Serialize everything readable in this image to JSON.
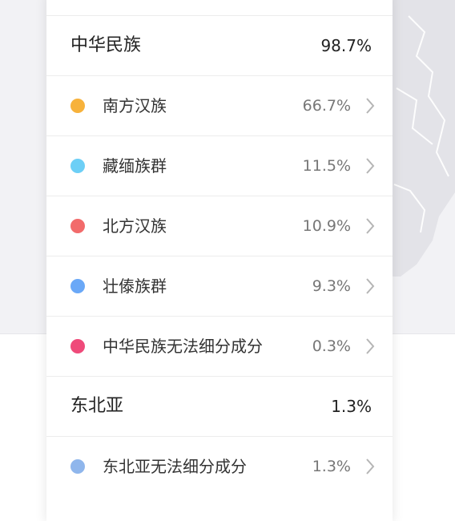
{
  "groups": [
    {
      "label": "中华民族",
      "value": "98.7%",
      "items": [
        {
          "label": "南方汉族",
          "value": "66.7%",
          "color": "#f7b23b"
        },
        {
          "label": "藏缅族群",
          "value": "11.5%",
          "color": "#6dcff6"
        },
        {
          "label": "北方汉族",
          "value": "10.9%",
          "color": "#f26b6b"
        },
        {
          "label": "壮傣族群",
          "value": "9.3%",
          "color": "#6aa8f7"
        },
        {
          "label": "中华民族无法细分成分",
          "value": "0.3%",
          "color": "#ef4a7a"
        }
      ]
    },
    {
      "label": "东北亚",
      "value": "1.3%",
      "items": [
        {
          "label": "东北亚无法细分成分",
          "value": "1.3%",
          "color": "#8fb6ec"
        }
      ]
    }
  ],
  "icons": {
    "chevron": "chevron-right-icon"
  }
}
